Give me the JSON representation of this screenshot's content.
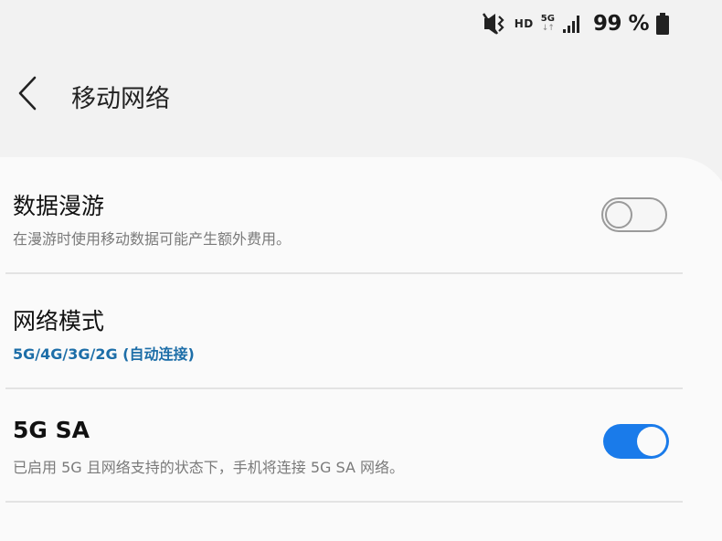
{
  "status_bar": {
    "hd": "HD",
    "network": "5G",
    "network_arrows": "↓↑",
    "battery_percent": "99 %"
  },
  "header": {
    "title": "移动网络"
  },
  "settings": {
    "roaming": {
      "title": "数据漫游",
      "subtitle": "在漫游时使用移动数据可能产生额外费用。",
      "enabled": false
    },
    "network_mode": {
      "title": "网络模式",
      "value": "5G/4G/3G/2G (自动连接)"
    },
    "sa": {
      "title": "5G SA",
      "subtitle": "已启用 5G 且网络支持的状态下，手机将连接 5G SA 网络。",
      "enabled": true
    }
  },
  "colors": {
    "accent": "#1a7bea",
    "link": "#1d6ea8",
    "background": "#f2f2f2",
    "card": "#fafafa"
  }
}
